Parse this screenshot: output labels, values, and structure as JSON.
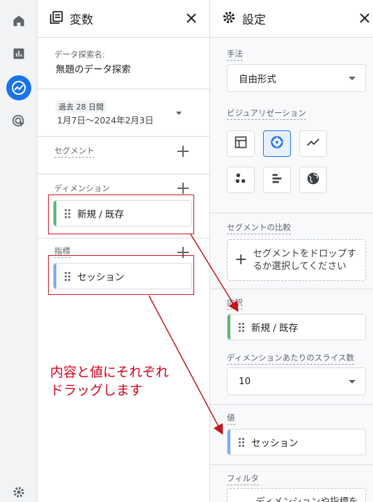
{
  "rail": {
    "icons": [
      "home-icon",
      "reports-icon",
      "explore-icon",
      "advertising-icon",
      "settings-icon"
    ]
  },
  "variables": {
    "title": "変数",
    "exploration_name_label": "データ探索名:",
    "exploration_name": "無題のデータ探索",
    "date_badge": "過去 28 日間",
    "date_range": "1月7日〜2024年2月3日",
    "segment_label": "セグメント",
    "dimension_label": "ディメンション",
    "dimension_chip": "新規 / 既存",
    "metric_label": "指標",
    "metric_chip": "セッション"
  },
  "settings": {
    "title": "設定",
    "technique_label": "手法",
    "technique_value": "自由形式",
    "visualization_label": "ビジュアリゼーション",
    "segment_compare_label": "セグメントの比較",
    "segment_drop_text": "セグメントをドロップするか選択してください",
    "rows_label": "内訳",
    "rows_chip": "新規 / 既存",
    "slices_label": "ディメンションあたりのスライス数",
    "slices_value": "10",
    "values_label": "値",
    "values_chip": "セッション",
    "filter_label": "フィルタ",
    "filter_text": "ディメンションや指標を"
  },
  "annotation": {
    "line1": "内容と値にそれぞれ",
    "line2": "ドラッグします"
  },
  "colors": {
    "accent": "#1a73e8",
    "dimension": "#5bb974",
    "metric": "#7baaf7",
    "annotation": "#d0021b"
  }
}
